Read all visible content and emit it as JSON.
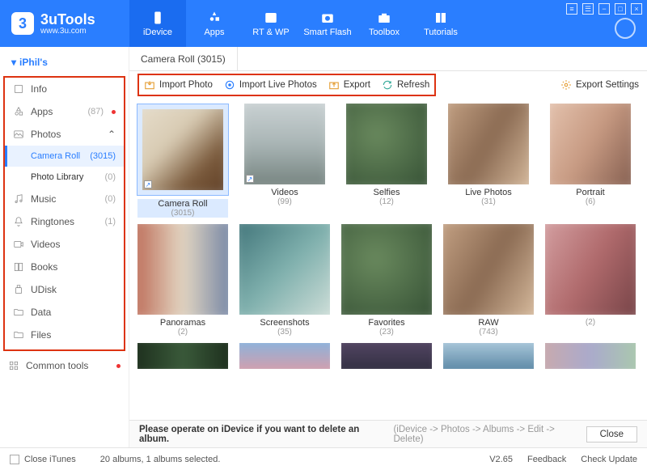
{
  "brand": {
    "name": "3uTools",
    "site": "www.3u.com",
    "badge": "3"
  },
  "nav": [
    {
      "label": "iDevice"
    },
    {
      "label": "Apps"
    },
    {
      "label": "RT & WP"
    },
    {
      "label": "Smart Flash"
    },
    {
      "label": "Toolbox"
    },
    {
      "label": "Tutorials"
    }
  ],
  "sidebar": {
    "owner": "iPhil's",
    "items": [
      {
        "label": "Info"
      },
      {
        "label": "Apps",
        "count": "(87)",
        "dot": true
      },
      {
        "label": "Photos",
        "expand": true
      },
      {
        "label": "Music",
        "count": "(0)"
      },
      {
        "label": "Ringtones",
        "count": "(1)"
      },
      {
        "label": "Videos"
      },
      {
        "label": "Books"
      },
      {
        "label": "UDisk"
      },
      {
        "label": "Data"
      },
      {
        "label": "Files"
      }
    ],
    "subs": [
      {
        "label": "Camera Roll",
        "count": "(3015)",
        "active": true
      },
      {
        "label": "Photo Library",
        "count": "(0)"
      }
    ],
    "common": "Common tools"
  },
  "tab": {
    "label": "Camera Roll (3015)"
  },
  "toolbar": {
    "import": "Import Photo",
    "importLive": "Import Live Photos",
    "export": "Export",
    "refresh": "Refresh",
    "settings": "Export Settings"
  },
  "albumsRow1": [
    {
      "name": "Camera Roll",
      "count": "(3015)",
      "pal": "p-room",
      "selected": true,
      "shortcut": true
    },
    {
      "name": "Videos",
      "count": "(99)",
      "pal": "p-water",
      "shortcut": true
    },
    {
      "name": "Selfies",
      "count": "(12)",
      "pal": "p-green"
    },
    {
      "name": "Live Photos",
      "count": "(31)",
      "pal": "p-warm"
    },
    {
      "name": "Portrait",
      "count": "(6)",
      "pal": "p-skin"
    }
  ],
  "albumsRow2": [
    {
      "name": "Panoramas",
      "count": "(2)",
      "pal": "p-multi"
    },
    {
      "name": "Screenshots",
      "count": "(35)",
      "pal": "p-teal"
    },
    {
      "name": "Favorites",
      "count": "(23)",
      "pal": "p-green"
    },
    {
      "name": "RAW",
      "count": "(743)",
      "pal": "p-warm"
    },
    {
      "name": "",
      "count": "(2)",
      "pal": "p-pinks"
    }
  ],
  "strip": [
    "p-dark1",
    "p-sky",
    "p-dusk",
    "p-sea",
    "p-mix"
  ],
  "notice": {
    "main": "Please operate on iDevice if you want to delete an album.",
    "hint": "(iDevice -> Photos -> Albums -> Edit -> Delete)",
    "close": "Close"
  },
  "footer": {
    "closeItunes": "Close iTunes",
    "status": "20 albums, 1 albums selected.",
    "version": "V2.65",
    "feedback": "Feedback",
    "update": "Check Update"
  }
}
